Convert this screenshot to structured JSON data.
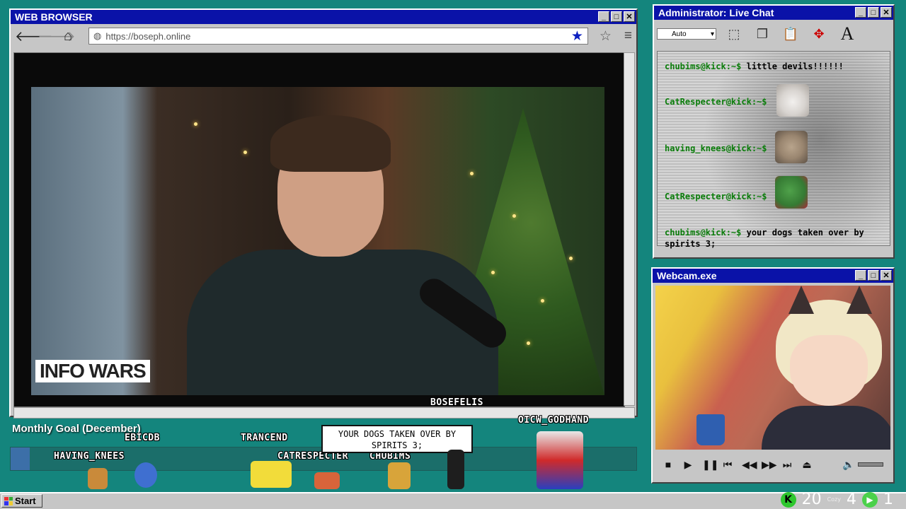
{
  "browser": {
    "title": "WEB BROWSER",
    "url": "https://boseph.online",
    "window_buttons": [
      "_",
      "□",
      "✕"
    ]
  },
  "video": {
    "logo_text": "INFO WARS"
  },
  "chat": {
    "title": "Administrator: Live Chat",
    "auto_select": "Auto",
    "messages": [
      {
        "user": "chubims@kick:~$",
        "text": "little devils!!!!!!"
      },
      {
        "user": "CatRespecter@kick:~$",
        "text": ""
      },
      {
        "user": "having_knees@kick:~$",
        "text": ""
      },
      {
        "user": "CatRespecter@kick:~$",
        "text": ""
      },
      {
        "user": "chubims@kick:~$",
        "text": "your dogs taken over by spirits 3;"
      }
    ],
    "emote_icons": [
      "cat-emote-icon",
      "dog-emote-icon",
      "frog-emote-icon"
    ]
  },
  "webcam": {
    "title": "Webcam.exe"
  },
  "overlay": {
    "goal_label": "Monthly Goal (December)",
    "goal_fraction": 0.03,
    "names": [
      "EBICDB",
      "TRANCEND",
      "BOSEFELIS",
      "OICW_GODHAND",
      "HAVING_KNEES",
      "CATRESPECTER",
      "CHUBIMS"
    ],
    "bubble": "YOUR DOGS TAKEN OVER BY SPIRITS 3;"
  },
  "taskbar": {
    "start_label": "Start",
    "stat1": "20",
    "stat1_sub": "Cozy",
    "stat2": "4",
    "stat3": "1"
  },
  "colors": {
    "desktop": "#14857d",
    "titlebar": "#0a12a8",
    "chat_user": "#0a7d0a"
  }
}
